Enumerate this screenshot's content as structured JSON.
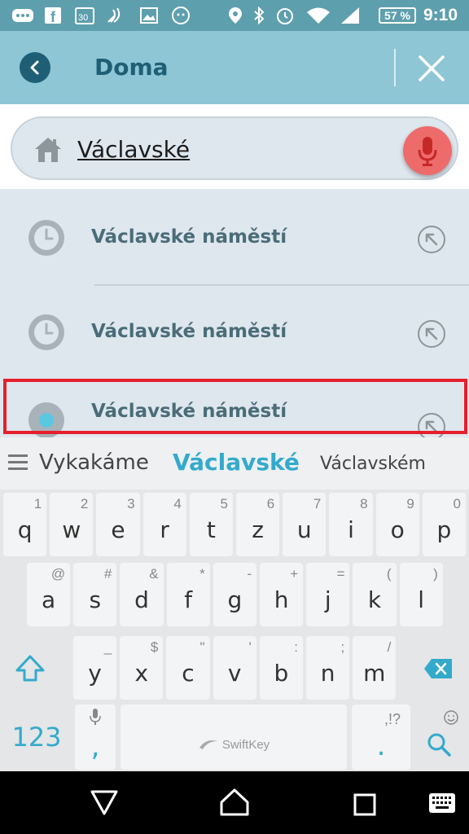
{
  "status_bar": {
    "battery": "57 %",
    "time": "9:10"
  },
  "header": {
    "title": "Doma"
  },
  "search": {
    "value": "Václavské"
  },
  "results": [
    {
      "label": "Václavské náměstí",
      "icon": "clock-icon"
    },
    {
      "label": "Václavské náměstí",
      "icon": "clock-icon"
    },
    {
      "label": "Václavské náměstí",
      "icon": "location-dot-icon"
    }
  ],
  "suggestions": {
    "left": "Vykakáme",
    "center": "Václavské",
    "right": "Václavském"
  },
  "keyboard": {
    "row1": [
      {
        "key": "q",
        "hint": "1"
      },
      {
        "key": "w",
        "hint": "2"
      },
      {
        "key": "e",
        "hint": "3"
      },
      {
        "key": "r",
        "hint": "4"
      },
      {
        "key": "t",
        "hint": "5"
      },
      {
        "key": "z",
        "hint": "6"
      },
      {
        "key": "u",
        "hint": "7"
      },
      {
        "key": "i",
        "hint": "8"
      },
      {
        "key": "o",
        "hint": "9"
      },
      {
        "key": "p",
        "hint": "0"
      }
    ],
    "row2": [
      {
        "key": "a",
        "hint": "@"
      },
      {
        "key": "s",
        "hint": "#"
      },
      {
        "key": "d",
        "hint": "&"
      },
      {
        "key": "f",
        "hint": "*"
      },
      {
        "key": "g",
        "hint": "-"
      },
      {
        "key": "h",
        "hint": "+"
      },
      {
        "key": "j",
        "hint": "="
      },
      {
        "key": "k",
        "hint": "("
      },
      {
        "key": "l",
        "hint": ")"
      }
    ],
    "row3": [
      {
        "key": "y",
        "hint": "_"
      },
      {
        "key": "x",
        "hint": "$"
      },
      {
        "key": "c",
        "hint": "\""
      },
      {
        "key": "v",
        "hint": "'"
      },
      {
        "key": "b",
        "hint": ":"
      },
      {
        "key": "n",
        "hint": ";"
      },
      {
        "key": "m",
        "hint": "/"
      }
    ],
    "numbers_label": "123",
    "comma": ",",
    "period": ".",
    "period_hint": ",!?",
    "space_brand": "SwiftKey"
  },
  "colors": {
    "accent": "#8ec6d6",
    "header_text": "#1e5f75",
    "mic": "#ee6b6b",
    "highlight": "#e5202c",
    "suggestion": "#33aacc"
  }
}
